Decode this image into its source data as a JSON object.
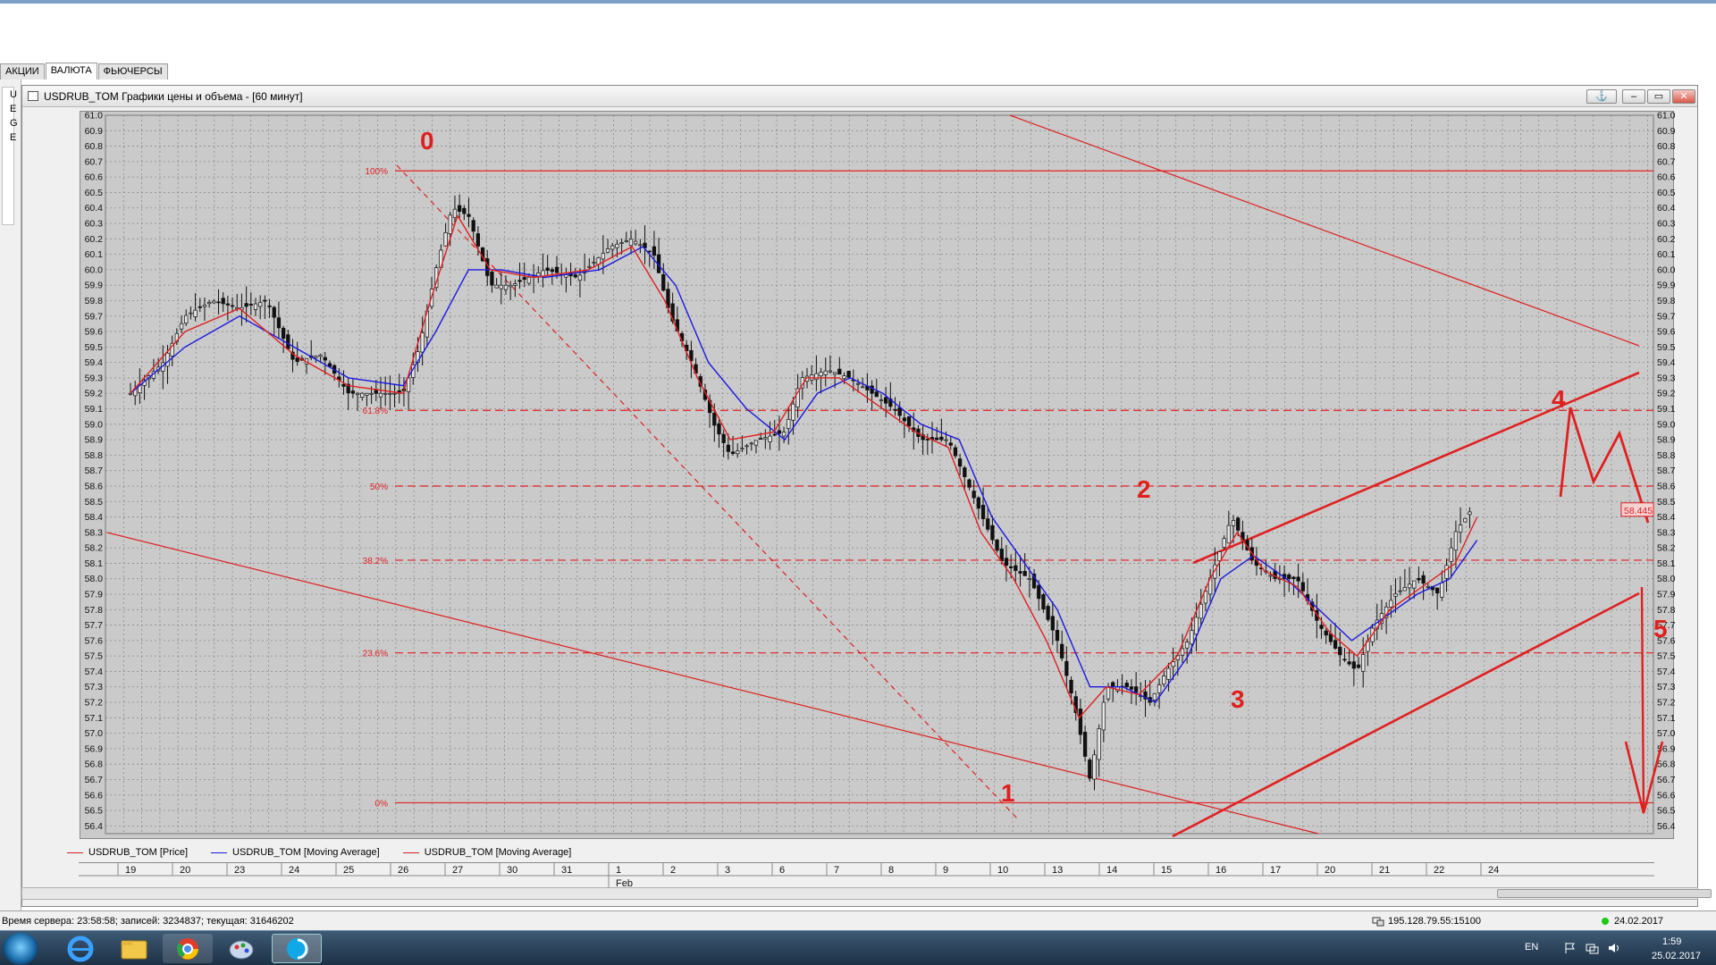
{
  "tabs": [
    {
      "label": "АКЦИИ",
      "active": false
    },
    {
      "label": "ВАЛЮТА",
      "active": true
    },
    {
      "label": "ФЬЮЧЕРСЫ",
      "active": false
    }
  ],
  "left_panel_letters": [
    "U",
    "E",
    "G",
    "E"
  ],
  "window": {
    "title": "USDRUB_TOM Графики цены и объема - [60 минут]",
    "buttons": {
      "anchor": "⚓",
      "minimize": "–",
      "restore": "▭",
      "close": "✕"
    }
  },
  "chart_data": {
    "type": "line",
    "ylim": [
      56.35,
      61.0
    ],
    "ytick_labels": [
      "61.0",
      "60.9",
      "60.8",
      "60.7",
      "60.6",
      "60.5",
      "60.4",
      "60.3",
      "60.2",
      "60.1",
      "60.0",
      "59.9",
      "59.8",
      "59.7",
      "59.6",
      "59.5",
      "59.4",
      "59.3",
      "59.2",
      "59.1",
      "59.0",
      "58.9",
      "58.8",
      "58.7",
      "58.6",
      "58.5",
      "58.4",
      "58.3",
      "58.2",
      "58.1",
      "58.0",
      "57.9",
      "57.8",
      "57.7",
      "57.6",
      "57.5",
      "57.4",
      "57.3",
      "57.2",
      "57.1",
      "57.0",
      "56.9",
      "56.8",
      "56.7",
      "56.6",
      "56.5",
      "56.4"
    ],
    "x_day_labels": [
      "19",
      "20",
      "23",
      "24",
      "25",
      "26",
      "27",
      "30",
      "31",
      "1",
      "2",
      "3",
      "6",
      "7",
      "8",
      "9",
      "10",
      "13",
      "14",
      "15",
      "16",
      "17",
      "20",
      "21",
      "22",
      "24"
    ],
    "x_month_label": "Feb",
    "fib_levels": [
      {
        "label": "100%",
        "value": 60.64
      },
      {
        "label": "61.8%",
        "value": 59.09
      },
      {
        "label": "50%",
        "value": 58.6
      },
      {
        "label": "38.2%",
        "value": 58.12
      },
      {
        "label": "23.6%",
        "value": 57.52
      },
      {
        "label": "0%",
        "value": 56.55
      }
    ],
    "wave_labels": [
      "0",
      "1",
      "2",
      "3",
      "4",
      "5"
    ],
    "current_price": "58.445",
    "price_path": [
      [
        0.0,
        59.2
      ],
      [
        0.6,
        59.4
      ],
      [
        1.0,
        59.7
      ],
      [
        1.5,
        59.8
      ],
      [
        2.0,
        59.75
      ],
      [
        2.5,
        59.8
      ],
      [
        3.0,
        59.4
      ],
      [
        3.5,
        59.45
      ],
      [
        4.0,
        59.2
      ],
      [
        4.5,
        59.2
      ],
      [
        5.0,
        59.2
      ],
      [
        5.3,
        59.5
      ],
      [
        5.6,
        60.0
      ],
      [
        5.9,
        60.4
      ],
      [
        6.2,
        60.35
      ],
      [
        6.6,
        59.9
      ],
      [
        7.0,
        59.9
      ],
      [
        7.6,
        60.0
      ],
      [
        8.2,
        59.95
      ],
      [
        8.8,
        60.15
      ],
      [
        9.2,
        60.2
      ],
      [
        9.6,
        60.1
      ],
      [
        9.9,
        59.7
      ],
      [
        10.3,
        59.4
      ],
      [
        10.7,
        59.0
      ],
      [
        11.0,
        58.8
      ],
      [
        11.5,
        58.9
      ],
      [
        12.0,
        58.95
      ],
      [
        12.3,
        59.3
      ],
      [
        12.8,
        59.35
      ],
      [
        13.2,
        59.3
      ],
      [
        13.6,
        59.2
      ],
      [
        14.0,
        59.1
      ],
      [
        14.5,
        58.9
      ],
      [
        15.0,
        58.9
      ],
      [
        15.5,
        58.5
      ],
      [
        16.0,
        58.1
      ],
      [
        16.5,
        58.0
      ],
      [
        17.0,
        57.6
      ],
      [
        17.3,
        57.2
      ],
      [
        17.6,
        56.7
      ],
      [
        17.9,
        57.3
      ],
      [
        18.3,
        57.3
      ],
      [
        18.7,
        57.2
      ],
      [
        19.0,
        57.4
      ],
      [
        19.4,
        57.6
      ],
      [
        19.8,
        58.0
      ],
      [
        20.2,
        58.4
      ],
      [
        20.6,
        58.1
      ],
      [
        21.0,
        58.0
      ],
      [
        21.4,
        58.0
      ],
      [
        21.8,
        57.7
      ],
      [
        22.2,
        57.5
      ],
      [
        22.5,
        57.4
      ],
      [
        22.8,
        57.7
      ],
      [
        23.2,
        57.9
      ],
      [
        23.6,
        58.0
      ],
      [
        24.0,
        57.9
      ],
      [
        24.3,
        58.3
      ],
      [
        24.6,
        58.45
      ]
    ],
    "ma_blue_path": [
      [
        0.0,
        59.2
      ],
      [
        1.0,
        59.5
      ],
      [
        2.0,
        59.7
      ],
      [
        3.0,
        59.5
      ],
      [
        4.0,
        59.3
      ],
      [
        5.0,
        59.25
      ],
      [
        5.6,
        59.6
      ],
      [
        6.2,
        60.0
      ],
      [
        6.8,
        60.0
      ],
      [
        7.6,
        59.95
      ],
      [
        8.6,
        60.0
      ],
      [
        9.4,
        60.15
      ],
      [
        10.0,
        59.9
      ],
      [
        10.6,
        59.4
      ],
      [
        11.3,
        59.1
      ],
      [
        12.0,
        58.9
      ],
      [
        12.6,
        59.2
      ],
      [
        13.2,
        59.3
      ],
      [
        13.8,
        59.2
      ],
      [
        14.5,
        59.0
      ],
      [
        15.2,
        58.9
      ],
      [
        15.8,
        58.4
      ],
      [
        16.4,
        58.1
      ],
      [
        17.0,
        57.8
      ],
      [
        17.6,
        57.3
      ],
      [
        18.2,
        57.3
      ],
      [
        18.8,
        57.2
      ],
      [
        19.4,
        57.5
      ],
      [
        20.0,
        58.0
      ],
      [
        20.6,
        58.15
      ],
      [
        21.2,
        58.0
      ],
      [
        21.8,
        57.8
      ],
      [
        22.4,
        57.6
      ],
      [
        23.0,
        57.75
      ],
      [
        23.6,
        57.9
      ],
      [
        24.2,
        58.0
      ],
      [
        24.7,
        58.25
      ]
    ],
    "ma_red_path": [
      [
        0.0,
        59.2
      ],
      [
        1.0,
        59.6
      ],
      [
        2.0,
        59.75
      ],
      [
        3.0,
        59.45
      ],
      [
        4.0,
        59.25
      ],
      [
        5.0,
        59.2
      ],
      [
        5.5,
        59.8
      ],
      [
        6.0,
        60.35
      ],
      [
        6.6,
        60.0
      ],
      [
        7.4,
        59.95
      ],
      [
        8.4,
        60.0
      ],
      [
        9.2,
        60.15
      ],
      [
        9.8,
        59.8
      ],
      [
        10.4,
        59.3
      ],
      [
        11.0,
        58.9
      ],
      [
        11.8,
        58.95
      ],
      [
        12.4,
        59.3
      ],
      [
        13.0,
        59.3
      ],
      [
        13.6,
        59.15
      ],
      [
        14.4,
        58.95
      ],
      [
        15.0,
        58.85
      ],
      [
        15.6,
        58.3
      ],
      [
        16.2,
        58.0
      ],
      [
        16.8,
        57.6
      ],
      [
        17.4,
        57.1
      ],
      [
        17.9,
        57.3
      ],
      [
        18.5,
        57.25
      ],
      [
        19.2,
        57.5
      ],
      [
        19.8,
        58.0
      ],
      [
        20.3,
        58.3
      ],
      [
        20.8,
        58.05
      ],
      [
        21.4,
        57.95
      ],
      [
        22.0,
        57.65
      ],
      [
        22.5,
        57.5
      ],
      [
        23.1,
        57.8
      ],
      [
        23.7,
        57.95
      ],
      [
        24.3,
        58.1
      ],
      [
        24.7,
        58.4
      ]
    ],
    "series": [
      {
        "name": "USDRUB_TOM [Price]",
        "color": "#d42020"
      },
      {
        "name": "USDRUB_TOM [Moving Average]",
        "color": "#1a1ae0"
      },
      {
        "name": "USDRUB_TOM [Moving Average]",
        "color": "#d42020"
      }
    ],
    "grid": true
  },
  "status": {
    "server": "Время сервера: 23:58:58; записей: 3234837; текущая: 31646202",
    "ip": "195.128.79.55:15100",
    "date": "24.02.2017"
  },
  "tray": {
    "lang": "EN",
    "time": "1:59",
    "date": "25.02.2017"
  }
}
